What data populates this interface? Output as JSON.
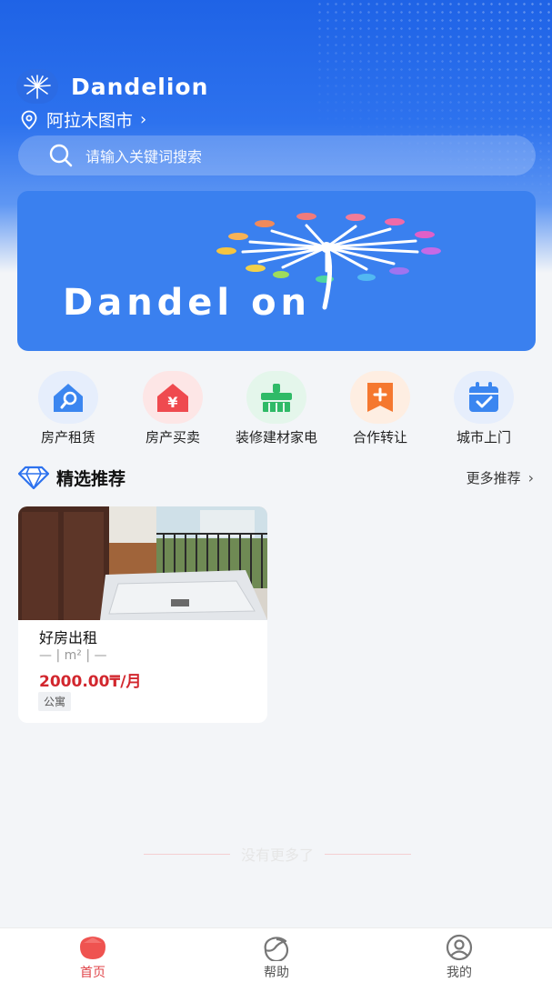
{
  "app": {
    "brand": "Dandelion",
    "banner_text": "Dandel on"
  },
  "location": {
    "city": "阿拉木图市"
  },
  "search": {
    "placeholder": "请输入关键词搜索"
  },
  "categories": [
    {
      "label": "房产租赁",
      "icon": "house-search-icon",
      "color": "#3b86f0"
    },
    {
      "label": "房产买卖",
      "icon": "house-yen-icon",
      "color": "#ef4a4f"
    },
    {
      "label": "装修建材家电",
      "icon": "paint-brush-icon",
      "color": "#2fba67"
    },
    {
      "label": "合作转让",
      "icon": "plus-note-icon",
      "color": "#f5782f"
    },
    {
      "label": "城市上门",
      "icon": "calendar-check-icon",
      "color": "#3b86f0"
    }
  ],
  "featured": {
    "title": "精选推荐",
    "more_label": "更多推荐"
  },
  "listings": [
    {
      "title": "好房出租",
      "meta": "— | m² | —",
      "price": "2000.00₸/月",
      "tag": "公寓"
    }
  ],
  "end_note": "没有更多了",
  "tabbar": {
    "items": [
      {
        "label": "首页",
        "icon": "home-icon",
        "active": true
      },
      {
        "label": "帮助",
        "icon": "help-icon",
        "active": false
      },
      {
        "label": "我的",
        "icon": "profile-icon",
        "active": false
      }
    ]
  },
  "colors": {
    "primary": "#2d72ee",
    "price": "#d2272e",
    "active_tab": "#e0454a"
  }
}
